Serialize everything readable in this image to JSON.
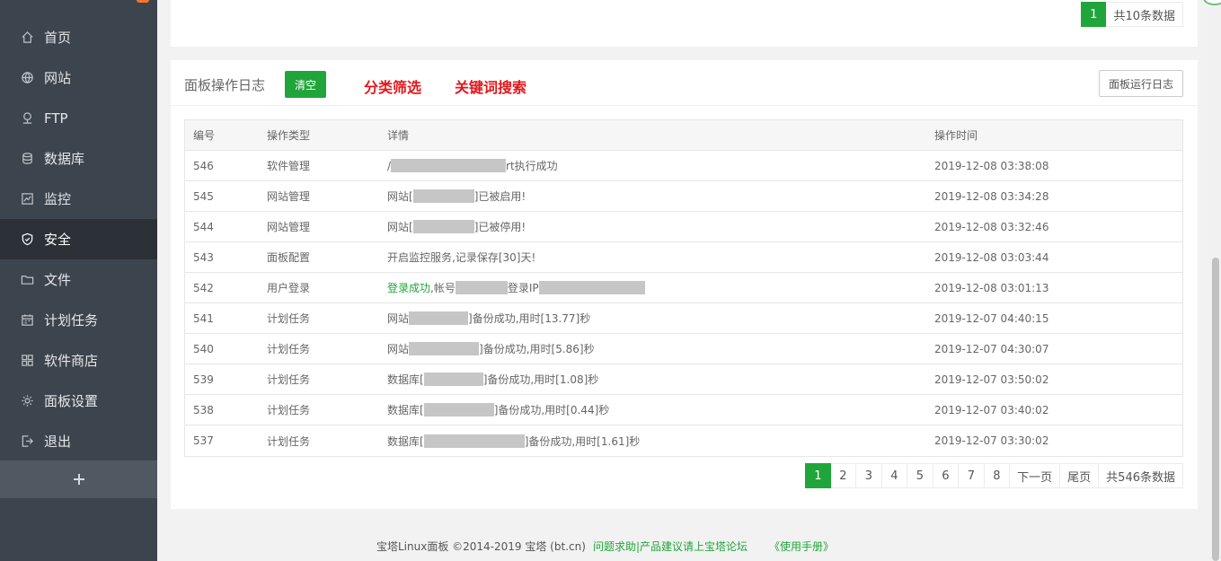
{
  "sidebar": {
    "items": [
      {
        "label": "首页",
        "icon": "home-icon"
      },
      {
        "label": "网站",
        "icon": "globe-icon"
      },
      {
        "label": "FTP",
        "icon": "ftp-icon"
      },
      {
        "label": "数据库",
        "icon": "database-icon"
      },
      {
        "label": "监控",
        "icon": "monitor-icon"
      },
      {
        "label": "安全",
        "icon": "shield-icon",
        "active": true
      },
      {
        "label": "文件",
        "icon": "folder-icon"
      },
      {
        "label": "计划任务",
        "icon": "calendar-icon"
      },
      {
        "label": "软件商店",
        "icon": "grid-icon"
      },
      {
        "label": "面板设置",
        "icon": "gear-icon"
      },
      {
        "label": "退出",
        "icon": "logout-icon"
      }
    ],
    "add_label": "+"
  },
  "top_panel": {
    "pager": {
      "current": "1",
      "total": "共10条数据"
    }
  },
  "log_panel": {
    "title": "面板操作日志",
    "clear_button": "清空",
    "filter_label": "分类筛选",
    "search_label": "关键词搜索",
    "run_log_button": "面板运行日志",
    "columns": [
      "编号",
      "操作类型",
      "详情",
      "操作时间"
    ],
    "rows": [
      {
        "id": "546",
        "type": "软件管理",
        "pre": "/",
        "mid": "",
        "post": "rt执行成功",
        "time": "2019-12-08 03:38:08"
      },
      {
        "id": "545",
        "type": "网站管理",
        "pre": "网站[",
        "mid": "",
        "post": "]已被启用!",
        "time": "2019-12-08 03:34:28"
      },
      {
        "id": "544",
        "type": "网站管理",
        "pre": "网站[",
        "mid": "",
        "post": "]已被停用!",
        "time": "2019-12-08 03:32:46"
      },
      {
        "id": "543",
        "type": "面板配置",
        "pre": "开启监控服务,记录保存[30]天!",
        "mid": "",
        "post": "",
        "time": "2019-12-08 03:03:44"
      },
      {
        "id": "542",
        "type": "用户登录",
        "pre": "登录成功",
        "mid": ",帐号",
        "post": "登录IP",
        "time": "2019-12-08 03:01:13"
      },
      {
        "id": "541",
        "type": "计划任务",
        "pre": "网站",
        "mid": "",
        "post": "]备份成功,用时[13.77]秒",
        "time": "2019-12-07 04:40:15"
      },
      {
        "id": "540",
        "type": "计划任务",
        "pre": "网站",
        "mid": "",
        "post": "]备份成功,用时[5.86]秒",
        "time": "2019-12-07 04:30:07"
      },
      {
        "id": "539",
        "type": "计划任务",
        "pre": "数据库[",
        "mid": "",
        "post": "]备份成功,用时[1.08]秒",
        "time": "2019-12-07 03:50:02"
      },
      {
        "id": "538",
        "type": "计划任务",
        "pre": "数据库[",
        "mid": "",
        "post": "]备份成功,用时[0.44]秒",
        "time": "2019-12-07 03:40:02"
      },
      {
        "id": "537",
        "type": "计划任务",
        "pre": "数据库[",
        "mid": "",
        "post": "]备份成功,用时[1.61]秒",
        "time": "2019-12-07 03:30:02"
      }
    ],
    "pager": {
      "pages": [
        "1",
        "2",
        "3",
        "4",
        "5",
        "6",
        "7",
        "8"
      ],
      "next": "下一页",
      "last": "尾页",
      "total": "共546条数据"
    }
  },
  "footer": {
    "copyright": "宝塔Linux面板 ©2014-2019 宝塔 (bt.cn)",
    "help_link": "问题求助|产品建议请上宝塔论坛",
    "manual_link": "《使用手册》"
  },
  "colors": {
    "accent": "#20a53a",
    "sidebar": "#3c444d",
    "highlight": "#e4161c"
  }
}
